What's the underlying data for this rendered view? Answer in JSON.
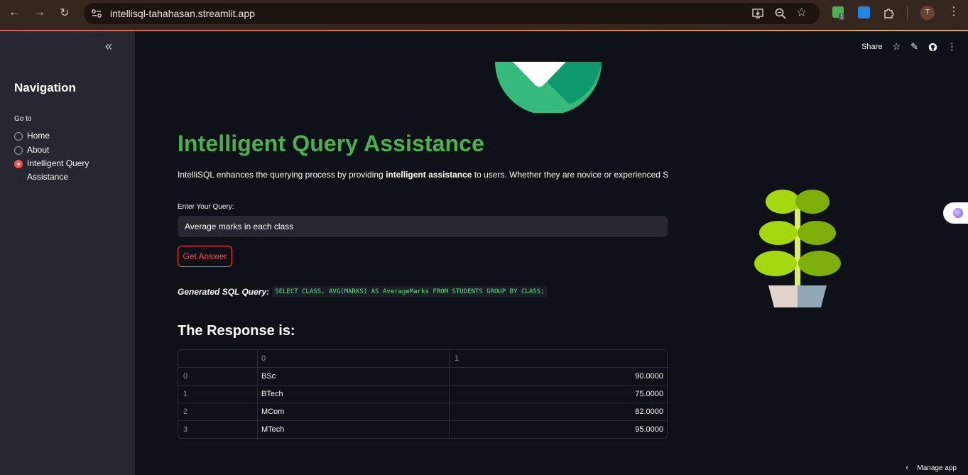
{
  "browser": {
    "url": "intellisql-tahahasan.streamlit.app",
    "badge_count": "1",
    "profile_initial": "T"
  },
  "sidebar": {
    "heading": "Navigation",
    "radio_label": "Go to",
    "options": [
      {
        "label": "Home",
        "selected": false
      },
      {
        "label": "About",
        "selected": false
      },
      {
        "label": "Intelligent Query Assistance",
        "selected": true
      }
    ]
  },
  "toolbar": {
    "share_label": "Share"
  },
  "main": {
    "title": "Intelligent Query Assistance",
    "intro_pre": "IntelliSQL enhances the querying process by providing ",
    "intro_bold": "intelligent assistance",
    "intro_post": " to users. Whether they are novice or experienced S",
    "input_label": "Enter Your Query:",
    "input_value": "Average marks in each class",
    "button_label": "Get Answer",
    "sql_label": "Generated SQL Query:",
    "sql_code": "SELECT CLASS, AVG(MARKS) AS AverageMarks FROM STUDENTS GROUP BY CLASS;",
    "response_title": "The Response is:"
  },
  "table": {
    "columns": [
      "",
      "0",
      "1"
    ],
    "rows": [
      [
        "0",
        "BSc",
        "90.0000"
      ],
      [
        "1",
        "BTech",
        "75.0000"
      ],
      [
        "2",
        "MCom",
        "82.0000"
      ],
      [
        "3",
        "MTech",
        "95.0000"
      ]
    ]
  },
  "footer": {
    "manage_label": "Manage app"
  },
  "colors": {
    "accent": "#ff4b4b",
    "title_green": "#4caf50",
    "code_green": "#5ce488"
  }
}
